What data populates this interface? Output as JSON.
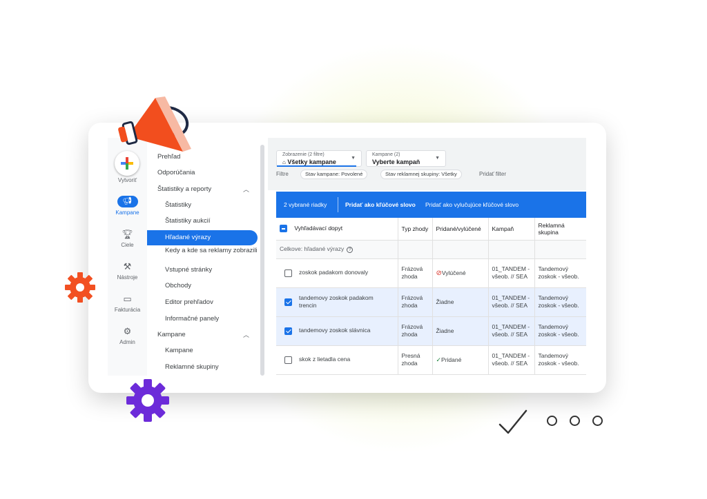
{
  "rail": {
    "create_label": "Vytvoriť",
    "items": [
      {
        "label": "Kampane",
        "icon": "megaphone-icon",
        "active": true
      },
      {
        "label": "Ciele",
        "icon": "trophy-icon"
      },
      {
        "label": "Nástroje",
        "icon": "tools-icon"
      },
      {
        "label": "Fakturácia",
        "icon": "card-icon"
      },
      {
        "label": "Admin",
        "icon": "gear-icon"
      }
    ]
  },
  "nav": {
    "items": [
      {
        "label": "Prehľad",
        "level": 1
      },
      {
        "label": "Odporúčania",
        "level": 1
      },
      {
        "label": "Štatistiky a reporty",
        "level": 1,
        "expanded": true
      },
      {
        "label": "Štatistiky",
        "level": 2
      },
      {
        "label": "Štatistiky aukcií",
        "level": 2
      },
      {
        "label": "Hľadané výrazy",
        "level": 2,
        "selected": true
      },
      {
        "label": "Kedy a kde sa reklamy zobrazili",
        "level": 2
      },
      {
        "label": "Vstupné stránky",
        "level": 2
      },
      {
        "label": "Obchody",
        "level": 2
      },
      {
        "label": "Editor prehľadov",
        "level": 2
      },
      {
        "label": "Informačné panely",
        "level": 2
      },
      {
        "label": "Kampane",
        "level": 1,
        "expanded": true
      },
      {
        "label": "Kampane",
        "level": 2
      },
      {
        "label": "Reklamné skupiny",
        "level": 2
      }
    ]
  },
  "topbar": {
    "view_caption": "Zobrazenie (2 filtre)",
    "view_value": "Všetky kampane",
    "campaign_caption": "Kampane (2)",
    "campaign_value": "Vyberte kampaň",
    "filters_label": "Filtre",
    "chips": [
      "Stav kampane: Povolené",
      "Stav reklamnej skupiny: Všetky"
    ],
    "add_filter": "Pridať filter"
  },
  "selection_bar": {
    "count": "2 vybrané riadky",
    "add_keyword": "Pridať ako kľúčové slovo",
    "add_negative": "Pridať ako vylučujúce kľúčové slovo"
  },
  "table": {
    "headers": [
      "Vyhľadávací dopyt",
      "Typ zhody",
      "Pridané/vylúčené",
      "Kampaň",
      "Reklamná skupina"
    ],
    "total_label": "Celkove: hľadané výrazy",
    "rows": [
      {
        "query": "zoskok padakom donovaly",
        "match": "Frázová zhoda",
        "status": "Vylúčené",
        "status_icon": "block-icon",
        "campaign": "01_TANDEM - všeob. // SEA",
        "adgroup": "Tandemový zoskok - všeob.",
        "checked": false
      },
      {
        "query": "tandemovy zoskok padakom trencin",
        "match": "Frázová zhoda",
        "status": "Žiadne",
        "status_icon": "",
        "campaign": "01_TANDEM - všeob. // SEA",
        "adgroup": "Tandemový zoskok - všeob.",
        "checked": true
      },
      {
        "query": "tandemovy zoskok slávnica",
        "match": "Frázová zhoda",
        "status": "Žiadne",
        "status_icon": "",
        "campaign": "01_TANDEM - všeob. // SEA",
        "adgroup": "Tandemový zoskok - všeob.",
        "checked": true
      },
      {
        "query": "skok z lietadla cena",
        "match": "Presná zhoda",
        "status": "Pridané",
        "status_icon": "check-icon",
        "campaign": "01_TANDEM - všeob. // SEA",
        "adgroup": "Tandemový zoskok - všeob.",
        "checked": false
      }
    ]
  },
  "colors": {
    "brand_blue": "#1a73e8",
    "megaphone_orange": "#f24e1e",
    "orange_gear": "#f25022",
    "purple_gear": "#6c2bd9"
  }
}
